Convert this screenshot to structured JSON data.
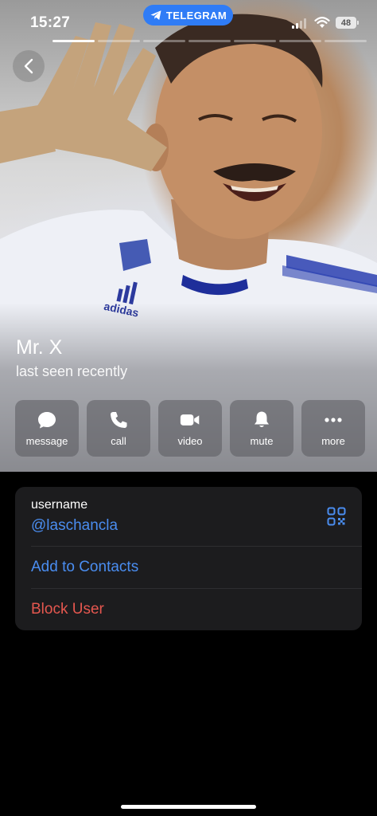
{
  "status_bar": {
    "time": "15:27",
    "app_pill": "TELEGRAM",
    "battery": "48",
    "icons": [
      "signal-icon",
      "wifi-icon",
      "battery-icon"
    ]
  },
  "story": {
    "segments": 7,
    "active_index": 0
  },
  "profile": {
    "name": "Mr. X",
    "status": "last seen recently",
    "photo": "profile photo of laughing man in white adidas jersey waving"
  },
  "actions": [
    {
      "label": "message",
      "icon": "message-icon"
    },
    {
      "label": "call",
      "icon": "phone-icon"
    },
    {
      "label": "video",
      "icon": "video-icon"
    },
    {
      "label": "mute",
      "icon": "bell-icon"
    },
    {
      "label": "more",
      "icon": "more-icon"
    }
  ],
  "info": {
    "username_caption": "username",
    "username_value": "@laschancla",
    "add_contact": "Add to Contacts",
    "block_user": "Block User"
  },
  "colors": {
    "accent": "#4a8df0",
    "danger": "#e5574f",
    "telegram_blue": "#2f7cf6",
    "card": "#1c1c1e"
  }
}
